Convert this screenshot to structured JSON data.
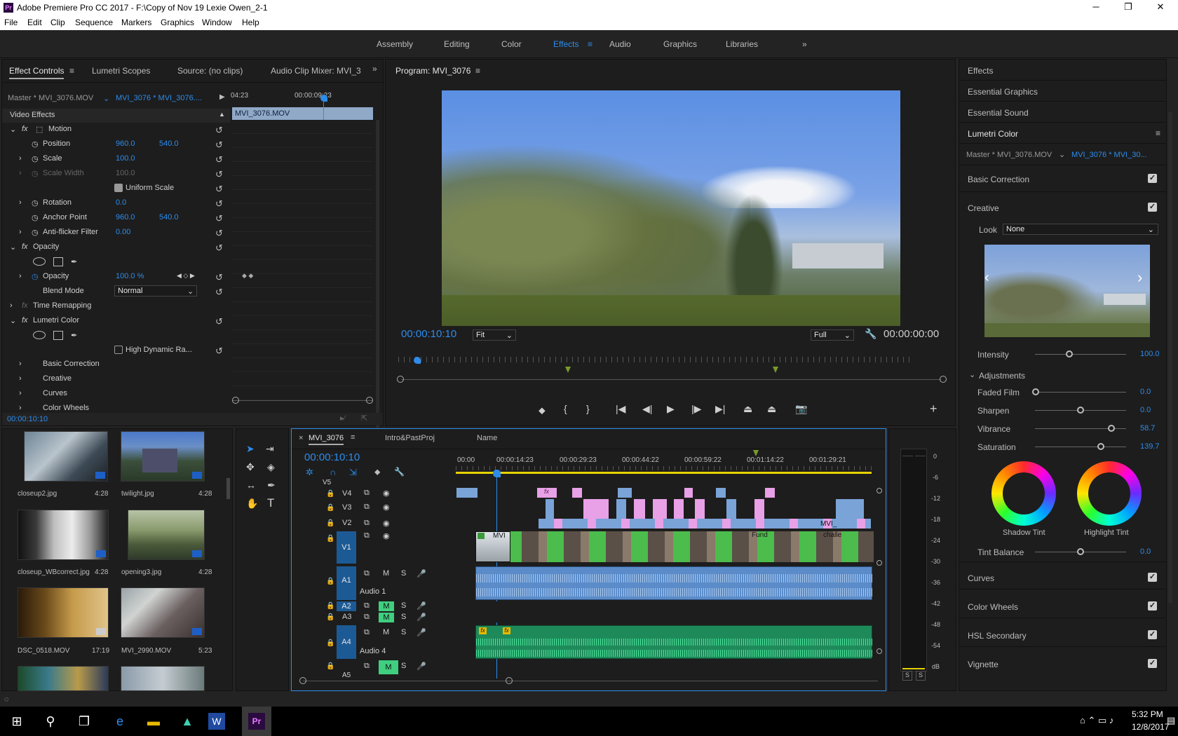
{
  "window": {
    "title": "Adobe Premiere Pro CC 2017 - F:\\Copy of Nov 19 Lexie Owen_2-1",
    "logo": "Pr"
  },
  "menu": [
    "File",
    "Edit",
    "Clip",
    "Sequence",
    "Markers",
    "Graphics",
    "Window",
    "Help"
  ],
  "workspaces": [
    "Assembly",
    "Editing",
    "Color",
    "Effects",
    "Audio",
    "Graphics",
    "Libraries"
  ],
  "active_workspace": "Effects",
  "effect_controls": {
    "tabs": [
      "Effect Controls",
      "Lumetri Scopes",
      "Source: (no clips)",
      "Audio Clip Mixer: MVI_3"
    ],
    "master": "Master * MVI_3076.MOV",
    "clip": "MVI_3076 * MVI_3076....",
    "time_left": "04:23",
    "time_right": "00:00:09:23",
    "clip_bar": "MVI_3076.MOV",
    "video_effects": "Video Effects",
    "motion": "Motion",
    "position_label": "Position",
    "position_x": "960.0",
    "position_y": "540.0",
    "scale_label": "Scale",
    "scale": "100.0",
    "scale_width_label": "Scale Width",
    "scale_width": "100.0",
    "uniform_label": "Uniform Scale",
    "rotation_label": "Rotation",
    "rotation": "0.0",
    "anchor_label": "Anchor Point",
    "anchor_x": "960.0",
    "anchor_y": "540.0",
    "flicker_label": "Anti-flicker Filter",
    "flicker": "0.00",
    "opacity_header": "Opacity",
    "opacity_label": "Opacity",
    "opacity": "100.0 %",
    "blend_label": "Blend Mode",
    "blend": "Normal",
    "time_remap": "Time Remapping",
    "lumetri": "Lumetri Color",
    "hdr": "High Dynamic Ra...",
    "basic": "Basic Correction",
    "creative": "Creative",
    "curves": "Curves",
    "wheels": "Color Wheels",
    "timecode": "00:00:10:10"
  },
  "program": {
    "title": "Program: MVI_3076",
    "timecode": "00:00:10:10",
    "fit": "Fit",
    "full": "Full",
    "duration": "00:00:00:00"
  },
  "lumetri_panel": {
    "panels": [
      "Effects",
      "Essential Graphics",
      "Essential Sound",
      "Lumetri Color"
    ],
    "master": "Master * MVI_3076.MOV",
    "clip": "MVI_3076 * MVI_30...",
    "basic": "Basic Correction",
    "creative": "Creative",
    "look_label": "Look",
    "look": "None",
    "intensity_label": "Intensity",
    "intensity": "100.0",
    "intensity_level": 0.35,
    "adjustments": "Adjustments",
    "faded_label": "Faded Film",
    "faded": "0.0",
    "faded_level": 0.0,
    "sharpen_label": "Sharpen",
    "sharpen": "0.0",
    "sharpen_level": 0.5,
    "vibrance_label": "Vibrance",
    "vibrance": "58.7",
    "vibrance_level": 0.8,
    "saturation_label": "Saturation",
    "saturation": "139.7",
    "saturation_level": 0.7,
    "shadow": "Shadow Tint",
    "highlight": "Highlight Tint",
    "tint_label": "Tint Balance",
    "tint": "0.0",
    "tint_level": 0.5,
    "curves": "Curves",
    "wheels": "Color Wheels",
    "hsl": "HSL Secondary",
    "vignette": "Vignette"
  },
  "project_items": [
    {
      "name": "closeup2.jpg",
      "dur": "4:28"
    },
    {
      "name": "twilight.jpg",
      "dur": "4:28"
    },
    {
      "name": "closeup_WBcorrect.jpg",
      "dur": "4:28"
    },
    {
      "name": "opening3.jpg",
      "dur": "4:28"
    },
    {
      "name": "DSC_0518.MOV",
      "dur": "17:19"
    },
    {
      "name": "MVI_2990.MOV",
      "dur": "5:23"
    }
  ],
  "timeline": {
    "tabs": [
      "MVI_3076",
      "Intro&PastProj",
      "Name"
    ],
    "timecode": "00:00:10:10",
    "ruler": [
      "00:00",
      "00:00:14:23",
      "00:00:29:23",
      "00:00:44:22",
      "00:00:59:22",
      "00:01:14:22",
      "00:01:29:21"
    ],
    "tracks": [
      "V5",
      "V4",
      "V3",
      "V2",
      "V1",
      "A1",
      "A2",
      "A3",
      "A4",
      "A5"
    ],
    "audio1": "Audio 1",
    "audio4": "Audio 4",
    "clip_labels": [
      "MVI",
      "Fund",
      "MVI_",
      "challe"
    ],
    "m": "M",
    "s": "S"
  },
  "meter": {
    "labels": [
      "0",
      "-6",
      "-12",
      "-18",
      "-24",
      "-30",
      "-36",
      "-42",
      "-48",
      "-54",
      "dB"
    ],
    "solo": "S"
  },
  "clock": {
    "time": "5:32 PM",
    "date": "12/8/2017"
  }
}
